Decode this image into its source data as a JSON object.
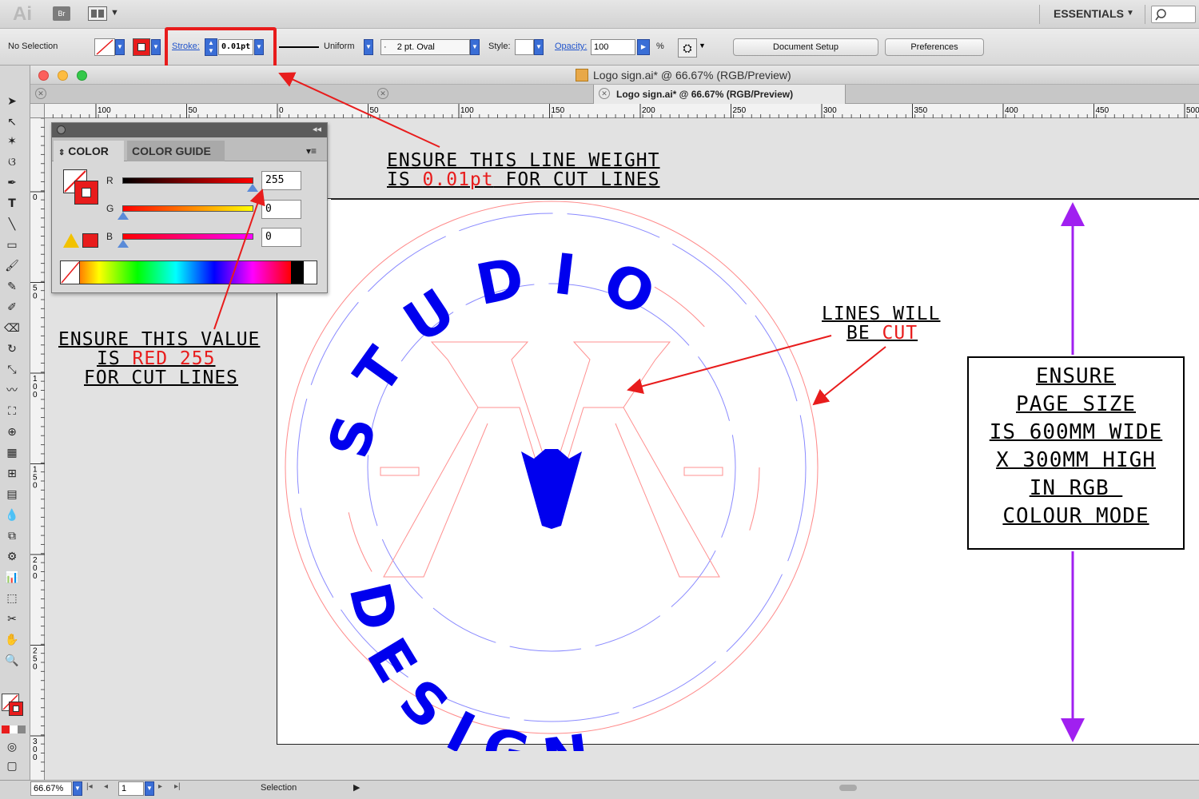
{
  "app": {
    "logo": "Ai",
    "bridge": "Br",
    "workspace": "ESSENTIALS",
    "window_title": "Logo sign.ai* @ 66.67% (RGB/Preview)",
    "tab_title": "Logo sign.ai* @ 66.67% (RGB/Preview)"
  },
  "control_bar": {
    "selection": "No Selection",
    "stroke_label": "Stroke:",
    "stroke_value": "0.01pt",
    "profile": "Uniform",
    "brush": "2 pt. Oval",
    "brush_prefix": "·",
    "style_label": "Style:",
    "opacity_label": "Opacity:",
    "opacity_value": "100",
    "opacity_unit": "%",
    "document_setup": "Document Setup",
    "preferences": "Preferences"
  },
  "ruler": {
    "h_labels": [
      "100",
      "50",
      "0",
      "50",
      "100",
      "150",
      "200",
      "250",
      "300",
      "350",
      "400",
      "450",
      "500"
    ],
    "v_labels": [
      "0",
      "50",
      "100",
      "150",
      "200",
      "250",
      "300"
    ]
  },
  "color_panel": {
    "tab_color": "COLOR",
    "tab_guide": "COLOR GUIDE",
    "r_label": "R",
    "g_label": "G",
    "b_label": "B",
    "r_value": "255",
    "g_value": "0",
    "b_value": "0"
  },
  "logo_art": {
    "top_text": "STUDIO",
    "bottom_text": "DESIGN",
    "colors": {
      "text": "#0000ee",
      "cut_line": "#ff8080",
      "blue_line": "#8a8aff"
    }
  },
  "annotations": {
    "stroke_note_line1": "ENSURE THIS LINE WEIGHT",
    "stroke_note_line2_pre": "IS ",
    "stroke_note_line2_red": "0.01pt",
    "stroke_note_line2_post": " FOR CUT LINES",
    "value_note_line1": "ENSURE THIS VALUE",
    "value_note_line2_pre": "IS ",
    "value_note_line2_red": "RED 255",
    "value_note_line3": "FOR CUT LINES",
    "cut_note_line1": "LINES WILL",
    "cut_note_line2_pre": "BE ",
    "cut_note_line2_red": "CUT",
    "page_note": [
      "ENSURE",
      "PAGE SIZE",
      "IS 600MM WIDE",
      "X 300MM HIGH",
      "IN RGB ",
      "COLOUR MODE"
    ],
    "colors": {
      "red": "#e81c1c",
      "arrow_red": "#e81c1c",
      "arrow_purple": "#a020f0"
    }
  },
  "status_bar": {
    "zoom": "66.67%",
    "page": "1",
    "tool": "Selection"
  }
}
